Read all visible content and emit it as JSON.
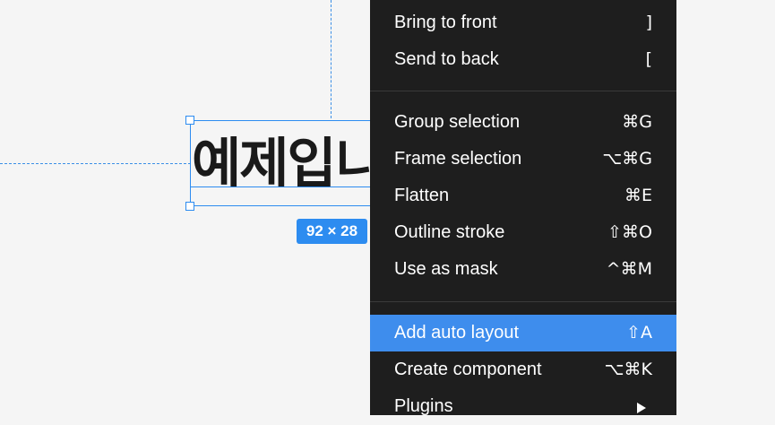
{
  "canvas": {
    "text_content": "예제입니다",
    "dimension_badge": "92 × 28",
    "selection_color": "#2d8cf0",
    "background_color": "#f5f5f5"
  },
  "context_menu": {
    "background_color": "#1e1e1e",
    "highlight_color": "#3e8ded",
    "groups": [
      {
        "items": [
          {
            "label": "Bring to front",
            "shortcut": "]"
          },
          {
            "label": "Send to back",
            "shortcut": "["
          }
        ]
      },
      {
        "items": [
          {
            "label": "Group selection",
            "shortcut": "⌘G"
          },
          {
            "label": "Frame selection",
            "shortcut": "⌥⌘G"
          },
          {
            "label": "Flatten",
            "shortcut": "⌘E"
          },
          {
            "label": "Outline stroke",
            "shortcut": "⇧⌘O"
          },
          {
            "label": "Use as mask",
            "shortcut": "^⌘M"
          }
        ]
      },
      {
        "items": [
          {
            "label": "Add auto layout",
            "shortcut": "⇧A",
            "highlighted": true
          },
          {
            "label": "Create component",
            "shortcut": "⌥⌘K"
          },
          {
            "label": "Plugins",
            "shortcut": "",
            "submenu_icon": "chevron-right-icon"
          }
        ]
      }
    ]
  }
}
